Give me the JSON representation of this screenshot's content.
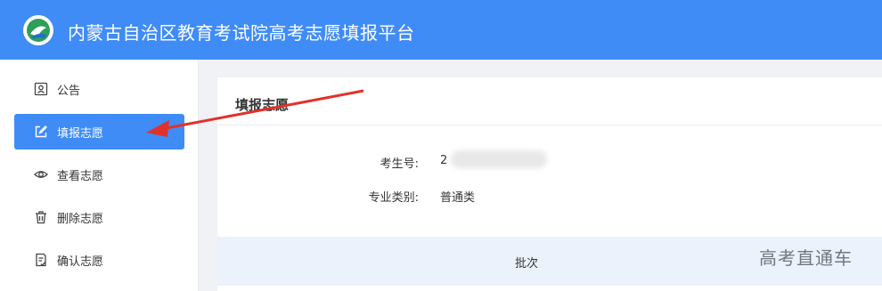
{
  "header": {
    "app_title": "内蒙古自治区教育考试院高考志愿填报平台",
    "logo_icon": "school-emblem-icon",
    "bg_color": "#3f8cf7"
  },
  "sidebar": {
    "items": [
      {
        "label": "公告",
        "icon": "announcement-icon",
        "active": false
      },
      {
        "label": "填报志愿",
        "icon": "edit-icon",
        "active": true
      },
      {
        "label": "查看志愿",
        "icon": "eye-icon",
        "active": false
      },
      {
        "label": "删除志愿",
        "icon": "trash-icon",
        "active": false
      },
      {
        "label": "确认志愿",
        "icon": "confirm-doc-icon",
        "active": false
      }
    ]
  },
  "main": {
    "title": "填报志愿",
    "fields": [
      {
        "label": "考生号:",
        "value": "2"
      },
      {
        "label": "专业类别:",
        "value": "普通类"
      }
    ],
    "table": {
      "headers": [
        "批次"
      ]
    }
  },
  "overlay": {
    "watermark": "高考直通车",
    "arrow_color": "#e0322b"
  }
}
